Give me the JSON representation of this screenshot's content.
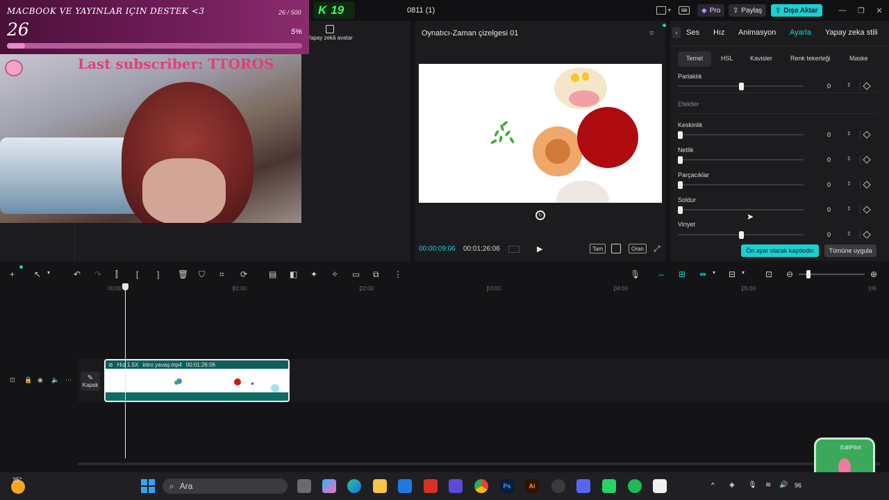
{
  "app": {
    "project_title": "0811 (1)",
    "pro_label": "Pro",
    "share_label": "Paylaş",
    "export_label": "Dışa Aktar"
  },
  "overlay": {
    "donation_title": "MACBOOK VE YAYINLAR IÇIN DESTEK <3",
    "donation_count": "26 / 500",
    "donation_amount": "26",
    "donation_percent": "5%",
    "donation_progress": 0.05,
    "subscriber_text": "Last subscriber: TTOROS",
    "k_badge_value": "19"
  },
  "media_panel": {
    "avatar_tab_label": "Yapay zekâ avatar"
  },
  "player": {
    "title": "Oynatıcı-Zaman çizelgesi 01",
    "current_time": "00:00:09:06",
    "total_time": "00:01:26:06",
    "full_label": "Tam",
    "ratio_label": "Oran"
  },
  "inspector": {
    "tabs": [
      "Ses",
      "Hız",
      "Animasyon",
      "Ayarla",
      "Yapay zeka stili"
    ],
    "active_tab": "Ayarla",
    "subtabs": [
      "Temel",
      "HSL",
      "Kavisler",
      "Renk tekerleği",
      "Maske"
    ],
    "section_effects": "Efektler",
    "params": [
      {
        "label": "Parlaklık",
        "value": "0",
        "level": 0.5
      },
      {
        "label": "Keskinlik",
        "value": "0",
        "level": 0.0
      },
      {
        "label": "Netlik",
        "value": "0",
        "level": 0.0
      },
      {
        "label": "Parçacıklar",
        "value": "0",
        "level": 0.0
      },
      {
        "label": "Soldur",
        "value": "0",
        "level": 0.0
      },
      {
        "label": "Vinyet",
        "value": "0",
        "level": 0.5
      }
    ],
    "save_preset_label": "Ön ayar olarak kaydedin",
    "apply_all_label": "Tümüne uygula"
  },
  "timeline": {
    "ticks": [
      "00:00",
      "01:00",
      "02:00",
      "03:00",
      "04:00",
      "05:00",
      "06"
    ],
    "clip_speed": "Hız 1.5X",
    "clip_name": "intro yavaş.mp4",
    "clip_duration": "00:01:26:06",
    "cover_label": "Kapak"
  },
  "taskbar": {
    "weather_temp": "35°",
    "search_placeholder": "Ara",
    "battery": "96"
  },
  "widget": {
    "label": "EditPilot"
  },
  "colors": {
    "accent": "#1ccfd0",
    "donation_bg": "#6e1c58",
    "subscriber_text": "#e0407a"
  }
}
